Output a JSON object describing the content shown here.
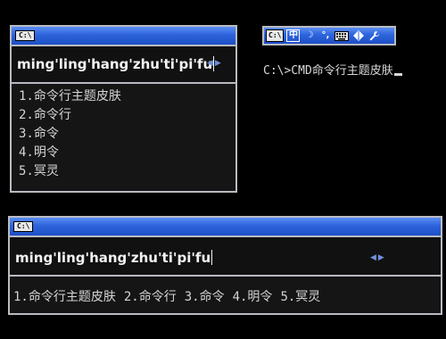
{
  "top_panel": {
    "app_icon_label": "C:\\",
    "pinyin": "ming'ling'hang'zhu'ti'pi'fu",
    "prev_page": "◀",
    "next_page": "▶",
    "candidates": [
      "1.命令行主题皮肤",
      "2.命令行",
      "3.命令",
      "4.明令",
      "5.冥灵"
    ]
  },
  "status_bar": {
    "app_icon_label": "C:\\",
    "lang_label": "中",
    "moon_icon": "☽",
    "punct_icon": "°,",
    "keyboard_icon": "keyboard-icon",
    "swap_icon": "arrows-icon",
    "wrench_icon": "wrench-icon"
  },
  "console": {
    "prompt": "C:\\>CMD",
    "typed_text": "命令行主题皮肤"
  },
  "bottom_panel": {
    "app_icon_label": "C:\\",
    "pinyin": "ming'ling'hang'zhu'ti'pi'fu",
    "prev_page": "◀",
    "next_page": "▶",
    "candidates": [
      "1.命令行主题皮肤",
      "2.命令行",
      "3.命令",
      "4.明令",
      "5.冥灵"
    ]
  }
}
